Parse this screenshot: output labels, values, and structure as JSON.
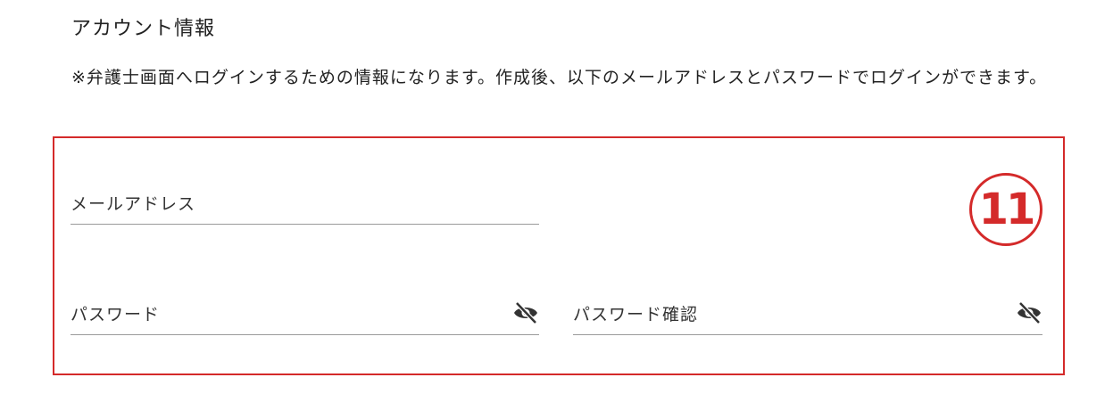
{
  "section": {
    "title": "アカウント情報",
    "description": "※弁護士画面へログインするための情報になります。作成後、以下のメールアドレスとパスワードでログインができます。"
  },
  "form": {
    "email": {
      "label": "メールアドレス",
      "value": ""
    },
    "password": {
      "label": "パスワード",
      "value": "",
      "toggle_icon": "eye-off-icon"
    },
    "password_confirm": {
      "label": "パスワード確認",
      "value": "",
      "toggle_icon": "eye-off-icon"
    }
  },
  "annotation": {
    "step_number": "11"
  },
  "colors": {
    "annotation": "#d42a2a",
    "text": "#222222",
    "underline": "#9a9a9a",
    "icon": "#333333"
  }
}
